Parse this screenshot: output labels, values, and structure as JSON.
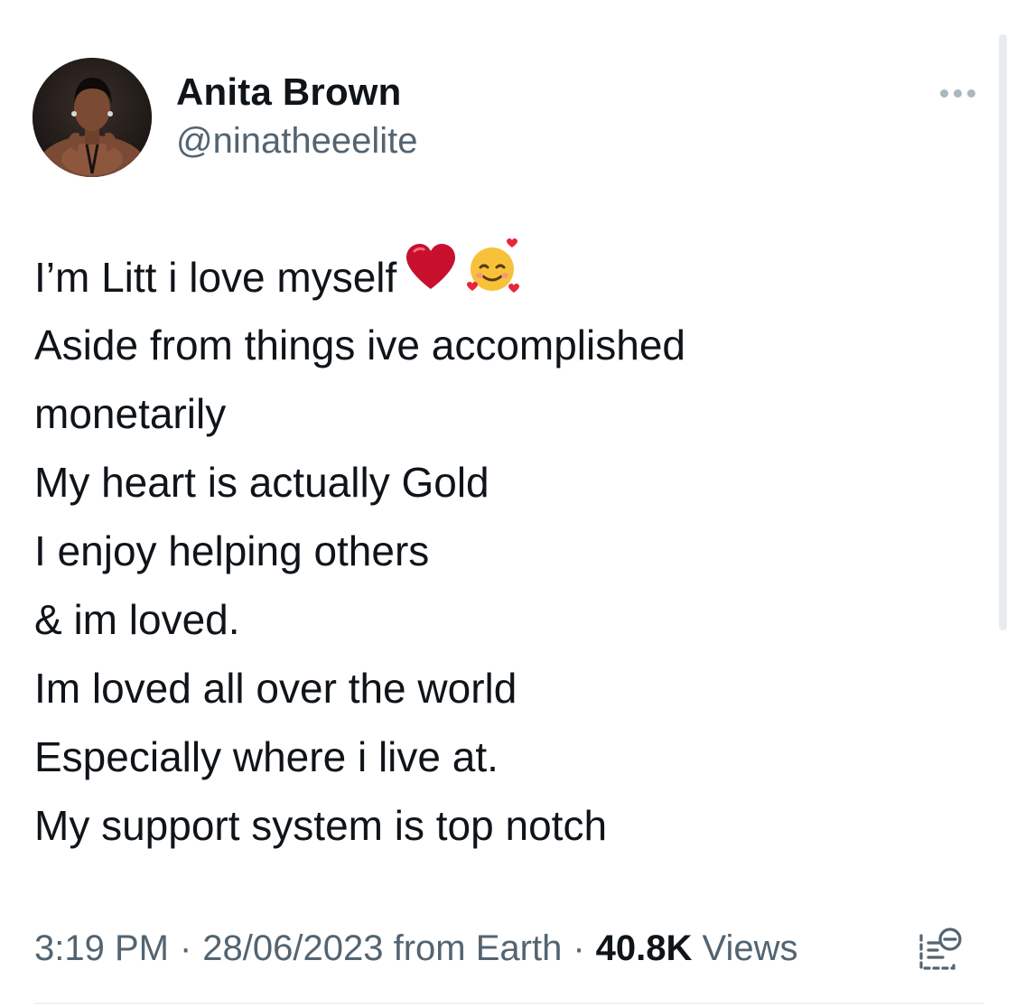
{
  "author": {
    "display_name": "Anita Brown",
    "handle": "@ninatheeelite"
  },
  "tweet": {
    "lines": [
      "I’m Litt i love myself",
      "Aside from things ive accomplished",
      "monetarily",
      "My heart is actually Gold",
      "I enjoy helping others",
      "& im loved.",
      "Im loved all over the world",
      "Especially where i live at.",
      "My support system is top notch"
    ],
    "emojis": [
      "red-heart-emoji",
      "smiling-face-with-hearts-emoji"
    ]
  },
  "meta": {
    "time": "3:19 PM",
    "separator": "·",
    "date": "28/06/2023",
    "source": "from Earth",
    "views_count": "40.8K",
    "views_label": "Views"
  },
  "icons": {
    "more": "more-horizontal-icon",
    "analytics": "analytics-icon"
  },
  "colors": {
    "text_primary": "#0f1419",
    "text_secondary": "#536471",
    "more_dots": "#aab8c2",
    "heart": "#c8102e",
    "face": "#f7c23a"
  }
}
